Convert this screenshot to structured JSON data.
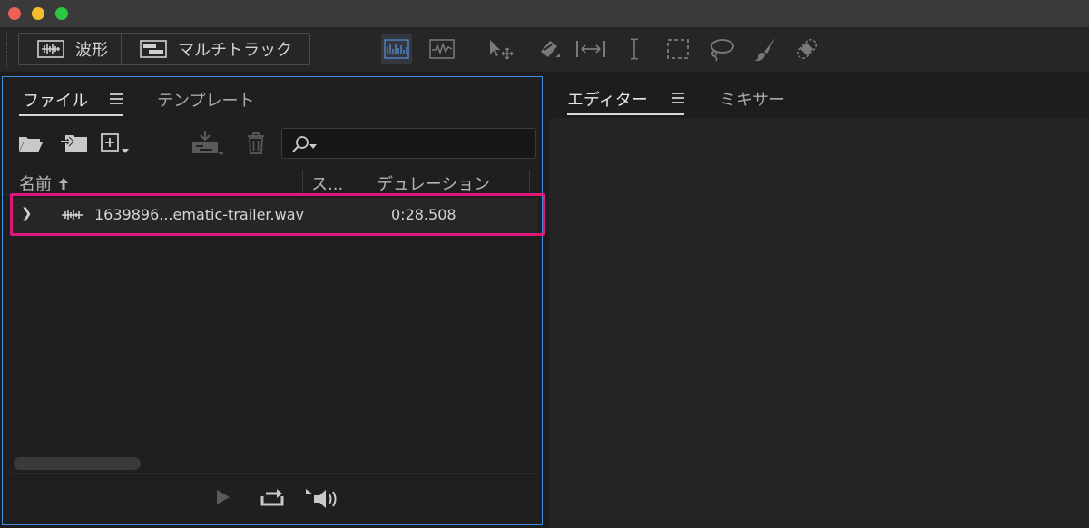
{
  "window": {
    "traffic_lights": [
      "#ee5f57",
      "#f6bc2f",
      "#29c840"
    ]
  },
  "toolbar": {
    "modes": [
      {
        "label": "波形",
        "icon": "waveform-view-icon"
      },
      {
        "label": "マルチトラック",
        "icon": "multitrack-view-icon"
      }
    ],
    "tools": [
      "spectral-frequency-icon",
      "spectral-pitch-icon",
      "move-tool-icon",
      "razor-tool-icon",
      "slip-tool-icon",
      "time-selection-tool-icon",
      "marquee-selection-tool-icon",
      "lasso-selection-tool-icon",
      "paintbrush-selection-tool-icon",
      "spot-healing-brush-icon"
    ]
  },
  "files_panel": {
    "tabs": [
      {
        "label": "ファイル",
        "active": true
      },
      {
        "label": "テンプレート",
        "active": false
      }
    ],
    "actions": [
      "open-folder-icon",
      "import-file-icon",
      "new-file-icon",
      "insert-into-multitrack-icon",
      "delete-icon"
    ],
    "search": {
      "value": "",
      "placeholder": ""
    },
    "columns": {
      "name": "名前",
      "status": "ス...",
      "duration": "デュレーション"
    },
    "rows": [
      {
        "name": "1639896...ematic-trailer.wav",
        "duration": "0:28.508",
        "selected": true
      }
    ],
    "highlight_color": "#e0177b",
    "focus_color": "#3f8fdf"
  },
  "editor_panel": {
    "tabs": [
      {
        "label": "エディター",
        "active": true
      },
      {
        "label": "ミキサー",
        "active": false
      }
    ]
  }
}
